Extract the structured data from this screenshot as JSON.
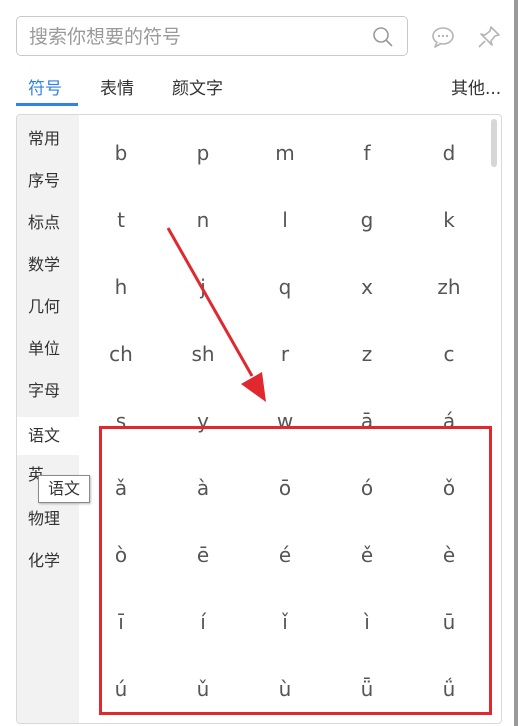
{
  "search": {
    "placeholder": "搜索你想要的符号"
  },
  "icons": {
    "search": "search-icon",
    "comment": "comment-icon",
    "pin": "pin-icon"
  },
  "tabs": [
    {
      "label": "符号",
      "active": true
    },
    {
      "label": "表情",
      "active": false
    },
    {
      "label": "颜文字",
      "active": false
    }
  ],
  "more_label": "其他...",
  "categories": [
    {
      "label": "常用"
    },
    {
      "label": "序号"
    },
    {
      "label": "标点"
    },
    {
      "label": "数学"
    },
    {
      "label": "几何"
    },
    {
      "label": "单位"
    },
    {
      "label": "字母"
    },
    {
      "label": "语文",
      "active": true
    },
    {
      "label": "英"
    },
    {
      "label": "物理"
    },
    {
      "label": "化学"
    }
  ],
  "tooltip": "语文",
  "symbols": [
    [
      "b",
      "p",
      "m",
      "f",
      "d"
    ],
    [
      "t",
      "n",
      "l",
      "g",
      "k"
    ],
    [
      "h",
      "j",
      "q",
      "x",
      "zh"
    ],
    [
      "ch",
      "sh",
      "r",
      "z",
      "c"
    ],
    [
      "s",
      "y",
      "w",
      "ā",
      "á"
    ],
    [
      "ǎ",
      "à",
      "ō",
      "ó",
      "ǒ"
    ],
    [
      "ò",
      "ē",
      "é",
      "ě",
      "è"
    ],
    [
      "ī",
      "í",
      "ǐ",
      "ì",
      "ū"
    ],
    [
      "ú",
      "ǔ",
      "ù",
      "ǖ",
      "ǘ"
    ]
  ],
  "colors": {
    "accent": "#2f82e6",
    "highlight": "#e0282e"
  }
}
